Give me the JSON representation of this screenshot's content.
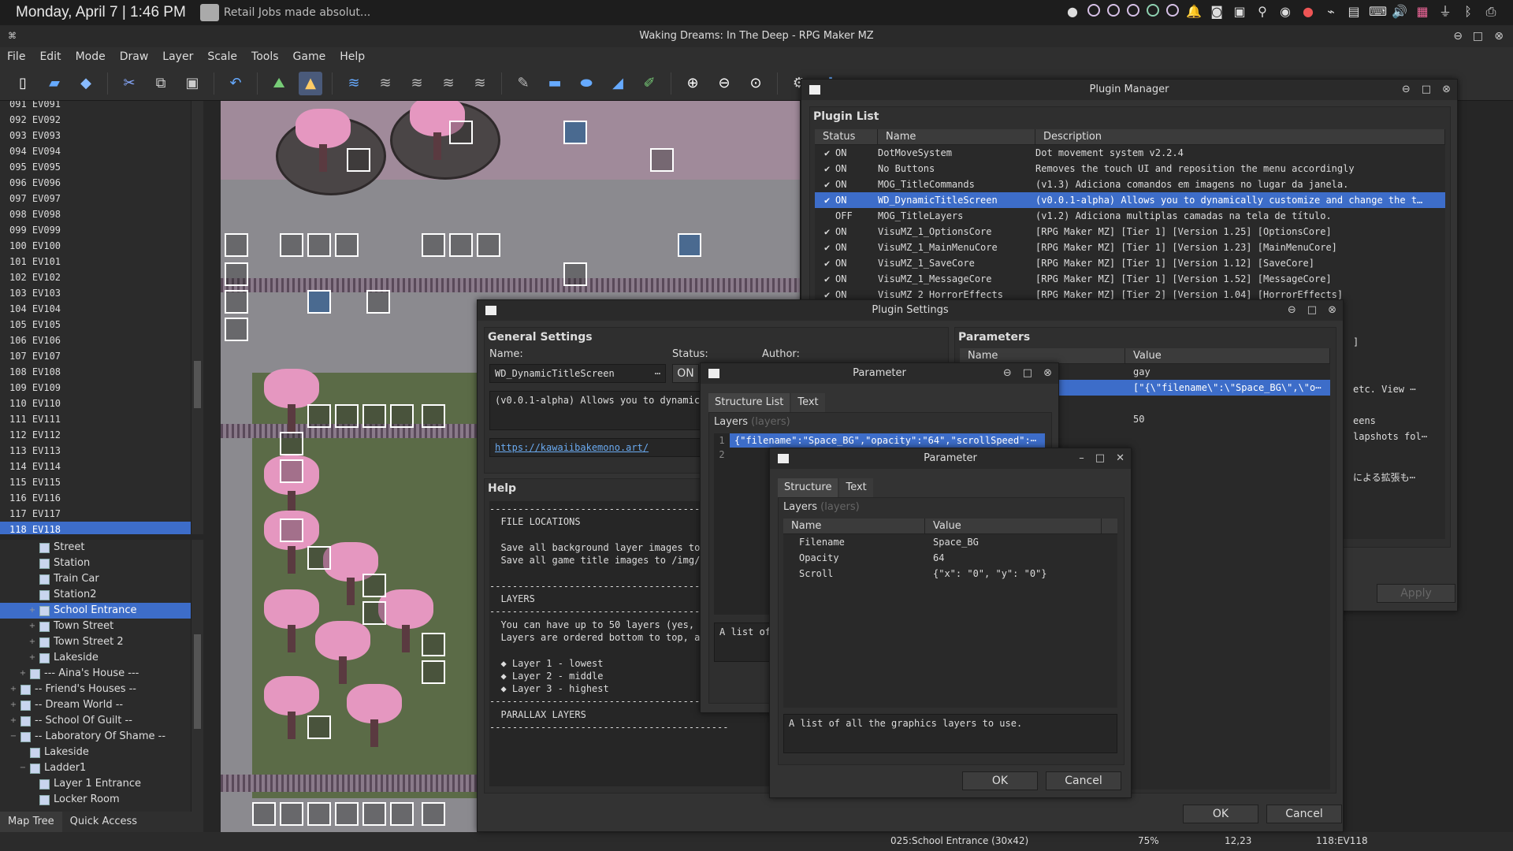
{
  "system": {
    "clock": "Monday, April 7 | 1:46 PM",
    "notification": "Retail Jobs made absolut...",
    "tray_dot_color": "#d6c0e6"
  },
  "window": {
    "title": "Waking Dreams: In The Deep - RPG Maker MZ"
  },
  "menu": [
    "File",
    "Edit",
    "Mode",
    "Draw",
    "Layer",
    "Scale",
    "Tools",
    "Game",
    "Help"
  ],
  "events": [
    {
      "label": "091 EV091"
    },
    {
      "label": "092 EV092"
    },
    {
      "label": "093 EV093"
    },
    {
      "label": "094 EV094"
    },
    {
      "label": "095 EV095"
    },
    {
      "label": "096 EV096"
    },
    {
      "label": "097 EV097"
    },
    {
      "label": "098 EV098"
    },
    {
      "label": "099 EV099"
    },
    {
      "label": "100 EV100"
    },
    {
      "label": "101 EV101"
    },
    {
      "label": "102 EV102"
    },
    {
      "label": "103 EV103"
    },
    {
      "label": "104 EV104"
    },
    {
      "label": "105 EV105"
    },
    {
      "label": "106 EV106"
    },
    {
      "label": "107 EV107"
    },
    {
      "label": "108 EV108"
    },
    {
      "label": "109 EV109"
    },
    {
      "label": "110 EV110"
    },
    {
      "label": "111 EV111"
    },
    {
      "label": "112 EV112"
    },
    {
      "label": "113 EV113"
    },
    {
      "label": "114 EV114"
    },
    {
      "label": "115 EV115"
    },
    {
      "label": "116 EV116"
    },
    {
      "label": "117 EV117"
    },
    {
      "label": "118 EV118",
      "selected": true
    }
  ],
  "maptree": [
    {
      "label": "Street",
      "depth": 3
    },
    {
      "label": "Station",
      "depth": 3
    },
    {
      "label": "Train Car",
      "depth": 3
    },
    {
      "label": "Station2",
      "depth": 3
    },
    {
      "label": "School Entrance",
      "depth": 3,
      "expand": "+",
      "selected": true
    },
    {
      "label": "Town Street",
      "depth": 3,
      "expand": "+"
    },
    {
      "label": "Town Street 2",
      "depth": 3,
      "expand": "+"
    },
    {
      "label": "Lakeside",
      "depth": 3,
      "expand": "+"
    },
    {
      "label": "--- Aina's House ---",
      "depth": 2,
      "expand": "+"
    },
    {
      "label": "-- Friend's Houses --",
      "depth": 1,
      "expand": "+"
    },
    {
      "label": "-- Dream World --",
      "depth": 1,
      "expand": "+"
    },
    {
      "label": "-- School Of Guilt --",
      "depth": 1,
      "expand": "+"
    },
    {
      "label": "-- Laboratory Of Shame --",
      "depth": 1,
      "expand": "−"
    },
    {
      "label": "Lakeside",
      "depth": 2
    },
    {
      "label": "Ladder1",
      "depth": 2,
      "expand": "−"
    },
    {
      "label": "Layer 1 Entrance",
      "depth": 3
    },
    {
      "label": "Locker Room",
      "depth": 3
    }
  ],
  "lefttabs": {
    "map_tree": "Map Tree",
    "quick_access": "Quick Access"
  },
  "status": {
    "map": "025:School Entrance (30x42)",
    "zoom": "75%",
    "coords": "12,23",
    "event": "118:EV118"
  },
  "plugin_manager": {
    "title": "Plugin Manager",
    "list_title": "Plugin List",
    "headers": {
      "status": "Status",
      "name": "Name",
      "description": "Description"
    },
    "rows": [
      {
        "status": "ON",
        "checked": true,
        "name": "DotMoveSystem",
        "desc": "Dot movement system v2.2.4"
      },
      {
        "status": "ON",
        "checked": true,
        "name": "No Buttons",
        "desc": "Removes the touch UI and reposition the menu accordingly"
      },
      {
        "status": "ON",
        "checked": true,
        "name": "MOG_TitleCommands",
        "desc": "(v1.3) Adiciona comandos em imagens no lugar da janela."
      },
      {
        "status": "ON",
        "checked": true,
        "name": "WD_DynamicTitleScreen",
        "desc": "(v0.0.1-alpha) Allows you to dynamically customize and change the t…",
        "selected": true
      },
      {
        "status": "OFF",
        "checked": false,
        "name": "MOG_TitleLayers",
        "desc": "(v1.2) Adiciona multiplas camadas na tela de título."
      },
      {
        "status": "ON",
        "checked": true,
        "name": "VisuMZ_1_OptionsCore",
        "desc": "[RPG Maker MZ] [Tier 1] [Version 1.25] [OptionsCore]"
      },
      {
        "status": "ON",
        "checked": true,
        "name": "VisuMZ_1_MainMenuCore",
        "desc": "[RPG Maker MZ] [Tier 1] [Version 1.23] [MainMenuCore]"
      },
      {
        "status": "ON",
        "checked": true,
        "name": "VisuMZ_1_SaveCore",
        "desc": "[RPG Maker MZ] [Tier 1] [Version 1.12] [SaveCore]"
      },
      {
        "status": "ON",
        "checked": true,
        "name": "VisuMZ_1_MessageCore",
        "desc": "[RPG Maker MZ] [Tier 1] [Version 1.52] [MessageCore]"
      },
      {
        "status": "ON",
        "checked": true,
        "name": "VisuMZ_2_HorrorEffects",
        "desc": "[RPG Maker MZ] [Tier 2] [Version 1.04] [HorrorEffects]"
      }
    ],
    "side_text": [
      {
        "t": "]"
      },
      {
        "t": "etc. View ⋯"
      },
      {
        "t": "eens"
      },
      {
        "t": "lapshots fol⋯"
      },
      {
        "t": "による拡張も⋯"
      }
    ],
    "apply": "Apply"
  },
  "plugin_settings": {
    "title": "Plugin Settings",
    "general": "General Settings",
    "name_label": "Name:",
    "status_label": "Status:",
    "author_label": "Author:",
    "name_value": "WD_DynamicTitleScreen",
    "status_value": "ON",
    "desc": "(v0.0.1-alpha) Allows you to dynamica",
    "url": "https://kawaiibakemono.art/",
    "help_title": "Help",
    "help_lines": [
      "------------------------------------------",
      "  FILE LOCATIONS",
      "",
      "  Save all background layer images to",
      "  Save all game title images to /img/",
      "",
      "------------------------------------------",
      "  LAYERS",
      "------------------------------------------",
      "  You can have up to 50 layers (yes,",
      "  Layers are ordered bottom to top, a",
      "",
      "  ◆ Layer 1 - lowest",
      "  ◆ Layer 2 - middle",
      "  ◆ Layer 3 - highest",
      "------------------------------------------",
      "  PARALLAX LAYERS",
      "------------------------------------------"
    ],
    "params_title": "Parameters",
    "p_name": "Name",
    "p_value": "Value",
    "params": [
      {
        "n": "ilename",
        "v": "gay"
      },
      {
        "n": "",
        "v": "[\"{\\\"filename\\\":\\\"Space_BG\\\",\\\"o⋯",
        "selected": true
      },
      {
        "n": "",
        "v": ""
      },
      {
        "n": "",
        "v": "50"
      }
    ],
    "ok": "OK",
    "cancel": "Cancel"
  },
  "param1": {
    "title": "Parameter",
    "tab1": "Structure List",
    "tab2": "Text",
    "layers_label": "Layers",
    "layers_hint": "(layers)",
    "line1": "1",
    "line1_val": "{\"filename\":\"Space_BG\",\"opacity\":\"64\",\"scrollSpeed\":⋯",
    "line2": "2",
    "desc": "A list of"
  },
  "param2": {
    "title": "Parameter",
    "tab1": "Structure",
    "tab2": "Text",
    "layers_label": "Layers",
    "layers_hint": "(layers)",
    "col_name": "Name",
    "col_value": "Value",
    "rows": [
      {
        "n": "Filename",
        "v": "Space_BG"
      },
      {
        "n": "Opacity",
        "v": "64"
      },
      {
        "n": "Scroll",
        "v": "{\"x\": \"0\", \"y\": \"0\"}"
      }
    ],
    "desc": "A list of all the graphics layers to use.",
    "ok": "OK",
    "cancel": "Cancel"
  }
}
